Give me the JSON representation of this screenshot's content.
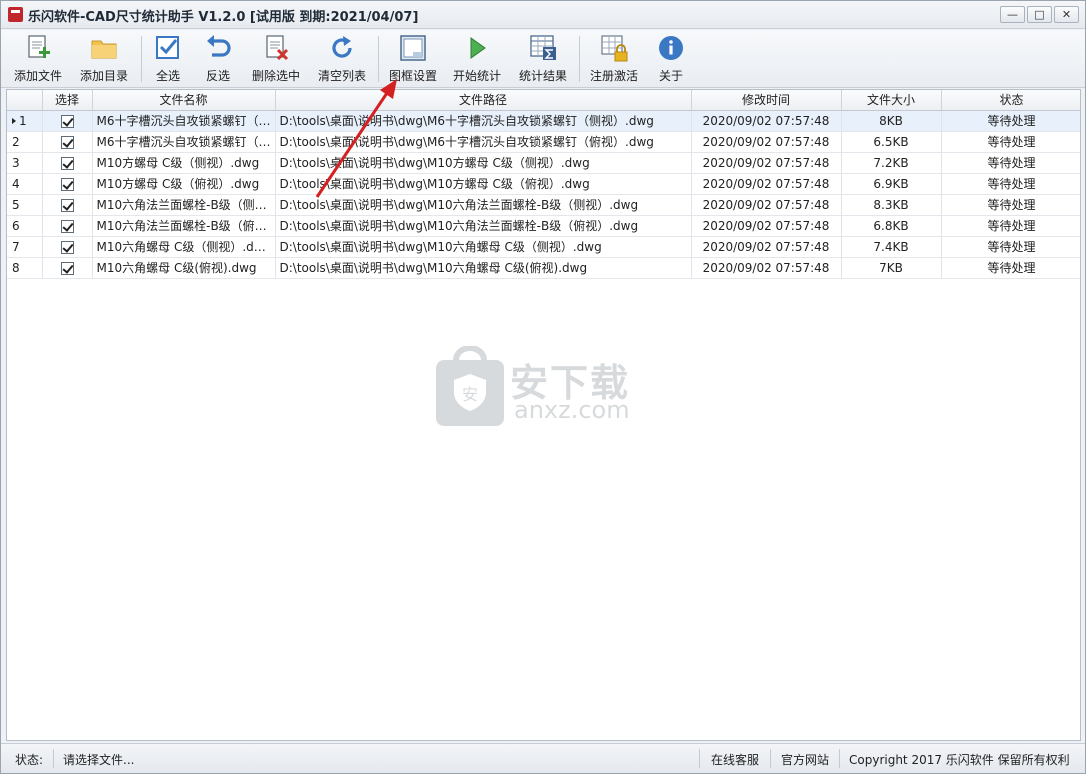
{
  "window": {
    "title": "乐闪软件-CAD尺寸统计助手 V1.2.0 [试用版 到期:2021/04/07]",
    "controls": {
      "minimize": "—",
      "maximize": "□",
      "close": "✕"
    }
  },
  "toolbar": {
    "add_file": "添加文件",
    "add_dir": "添加目录",
    "select_all": "全选",
    "invert": "反选",
    "delete_selected": "删除选中",
    "clear_list": "清空列表",
    "frame_settings": "图框设置",
    "start_stats": "开始统计",
    "stats_result": "统计结果",
    "register": "注册激活",
    "about": "关于"
  },
  "table": {
    "headers": [
      "",
      "选择",
      "文件名称",
      "文件路径",
      "修改时间",
      "文件大小",
      "状态"
    ],
    "rows": [
      {
        "no": "1",
        "name": "M6十字槽沉头自攻锁紧螺钉（…",
        "path": "D:\\tools\\桌面\\说明书\\dwg\\M6十字槽沉头自攻锁紧螺钉（侧视）.dwg",
        "time": "2020/09/02 07:57:48",
        "size": "8KB",
        "status": "等待处理"
      },
      {
        "no": "2",
        "name": "M6十字槽沉头自攻锁紧螺钉（…",
        "path": "D:\\tools\\桌面\\说明书\\dwg\\M6十字槽沉头自攻锁紧螺钉（俯视）.dwg",
        "time": "2020/09/02 07:57:48",
        "size": "6.5KB",
        "status": "等待处理"
      },
      {
        "no": "3",
        "name": "M10方螺母 C级（侧视）.dwg",
        "path": "D:\\tools\\桌面\\说明书\\dwg\\M10方螺母 C级（侧视）.dwg",
        "time": "2020/09/02 07:57:48",
        "size": "7.2KB",
        "status": "等待处理"
      },
      {
        "no": "4",
        "name": "M10方螺母 C级（俯视）.dwg",
        "path": "D:\\tools\\桌面\\说明书\\dwg\\M10方螺母 C级（俯视）.dwg",
        "time": "2020/09/02 07:57:48",
        "size": "6.9KB",
        "status": "等待处理"
      },
      {
        "no": "5",
        "name": "M10六角法兰面螺栓-B级（侧…",
        "path": "D:\\tools\\桌面\\说明书\\dwg\\M10六角法兰面螺栓-B级（侧视）.dwg",
        "time": "2020/09/02 07:57:48",
        "size": "8.3KB",
        "status": "等待处理"
      },
      {
        "no": "6",
        "name": "M10六角法兰面螺栓-B级（俯…",
        "path": "D:\\tools\\桌面\\说明书\\dwg\\M10六角法兰面螺栓-B级（俯视）.dwg",
        "time": "2020/09/02 07:57:48",
        "size": "6.8KB",
        "status": "等待处理"
      },
      {
        "no": "7",
        "name": "M10六角螺母 C级（侧视）.dwg",
        "path": "D:\\tools\\桌面\\说明书\\dwg\\M10六角螺母 C级（侧视）.dwg",
        "time": "2020/09/02 07:57:48",
        "size": "7.4KB",
        "status": "等待处理"
      },
      {
        "no": "8",
        "name": "M10六角螺母 C级(俯视).dwg",
        "path": "D:\\tools\\桌面\\说明书\\dwg\\M10六角螺母 C级(俯视).dwg",
        "time": "2020/09/02 07:57:48",
        "size": "7KB",
        "status": "等待处理"
      }
    ]
  },
  "watermark": {
    "text": "安下载",
    "sub": "anxz.com",
    "badge": "安"
  },
  "statusbar": {
    "label": "状态:",
    "message": "请选择文件...",
    "online_service": "在线客服",
    "official_site": "官方网站",
    "copyright": "Copyright 2017 乐闪软件 保留所有权利"
  },
  "colors": {
    "arrow": "#d42020",
    "accent": "#3a78c3",
    "selected_row": "#e8f0fb"
  }
}
